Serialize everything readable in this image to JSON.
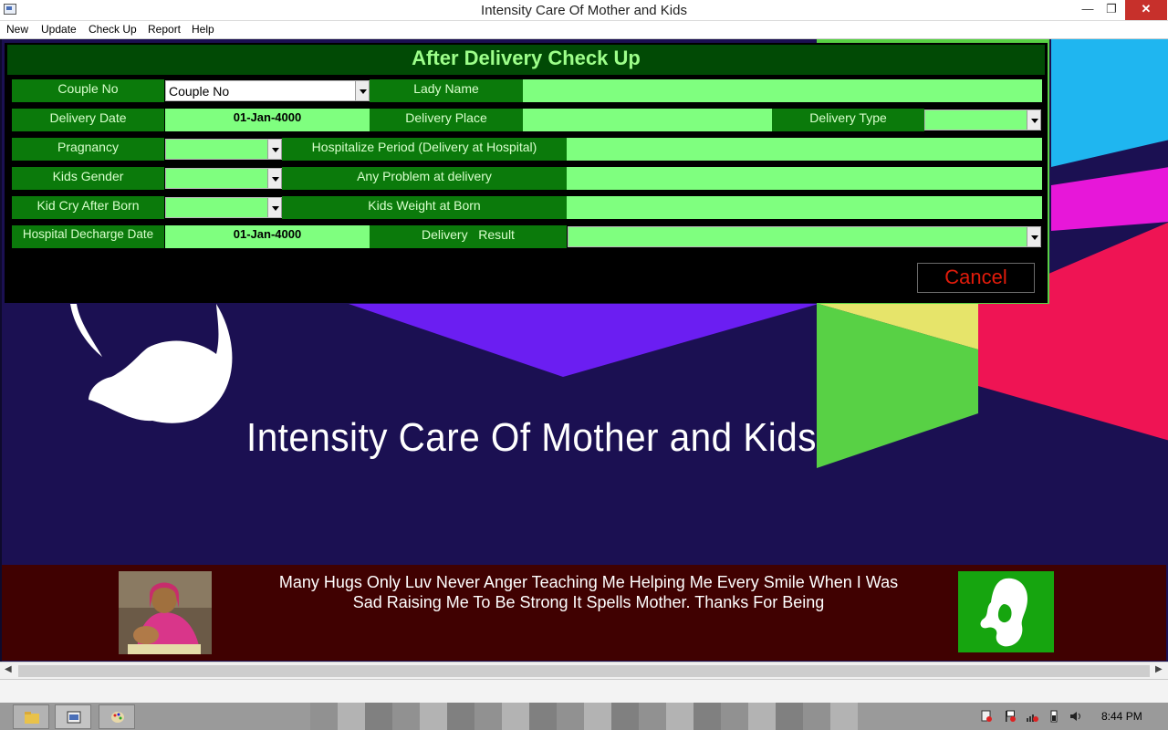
{
  "window": {
    "title": "Intensity Care Of Mother and Kids",
    "controls": {
      "minimize": "—",
      "maximize": "❐",
      "close": "✕"
    }
  },
  "menu": [
    "New",
    "Update",
    "Check Up",
    "Report",
    "Help"
  ],
  "form": {
    "title": "After Delivery Check Up",
    "labels": {
      "couple_no": "Couple No",
      "lady_name": "Lady Name",
      "delivery_date": "Delivery Date",
      "delivery_place": "Delivery Place",
      "delivery_type": "Delivery Type",
      "pregnancy": "Pragnancy",
      "hospitalize_period": "Hospitalize Period (Delivery at Hospital)",
      "kids_gender": "Kids Gender",
      "any_problem": "Any Problem at delivery",
      "kid_cry": "Kid Cry After Born",
      "kids_weight": "Kids Weight at Born",
      "discharge_date": "Hospital Decharge Date",
      "delivery_result": "Delivery   Result"
    },
    "values": {
      "couple_no": "Couple No",
      "lady_name": "",
      "delivery_date": "01-Jan-4000",
      "delivery_place": "",
      "delivery_type": "",
      "pregnancy": "",
      "hospitalize_period": "",
      "kids_gender": "",
      "any_problem": "",
      "kid_cry": "",
      "kids_weight": "",
      "discharge_date": "01-Jan-4000",
      "delivery_result": ""
    },
    "cancel_label": "Cancel"
  },
  "banner": {
    "title": "Intensity Care Of Mother and Kids"
  },
  "footer": {
    "quote_line1": "Many Hugs Only Luv Never Anger Teaching Me Helping Me Every Smile When I Was",
    "quote_line2": "Sad Raising Me To Be Strong It Spells Mother. Thanks For Being"
  },
  "taskbar": {
    "clock": "8:44 PM",
    "tray_icons": [
      "action-center-icon",
      "flag-icon",
      "network-icon",
      "power-icon",
      "volume-icon"
    ]
  },
  "colors": {
    "form_label_bg": "#0b7a0b",
    "form_field_bg": "#7fff7f",
    "form_title_bg": "#014a05",
    "cancel_text": "#e01b0b",
    "background": "#1b1052",
    "footer_bg": "#400101"
  }
}
